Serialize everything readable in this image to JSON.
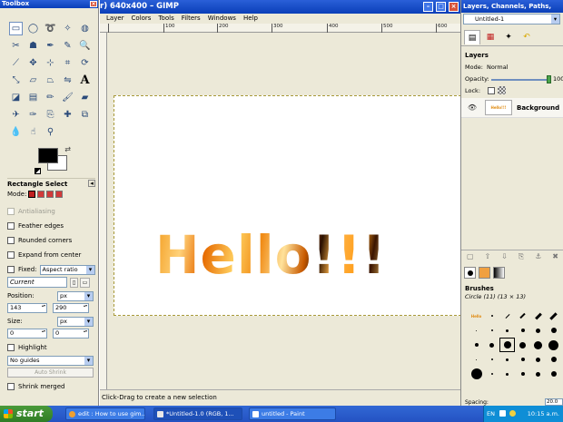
{
  "toolbox": {
    "title": "Toolbox",
    "tool_options_title": "Rectangle Select",
    "mode_label": "Mode:",
    "antialiasing": "Antialiasing",
    "feather_edges": "Feather edges",
    "rounded_corners": "Rounded corners",
    "expand_from_center": "Expand from center",
    "fixed_label": "Fixed:",
    "fixed_value": "Aspect ratio",
    "current_value": "Current",
    "position_label": "Position:",
    "position_unit": "px",
    "pos_x": "143",
    "pos_y": "290",
    "size_label": "Size:",
    "size_unit": "px",
    "size_w": "0",
    "size_h": "0",
    "highlight": "Highlight",
    "guides_value": "No guides",
    "auto_shrink": "Auto Shrink",
    "shrink_merged": "Shrink merged"
  },
  "image_window": {
    "title": "r) 640x400 – GIMP",
    "menu": [
      "Layer",
      "Colors",
      "Tools",
      "Filters",
      "Windows",
      "Help"
    ],
    "ruler_ticks": [
      "100",
      "200",
      "300",
      "400",
      "500",
      "600"
    ],
    "canvas_text": "Hello!!!",
    "status": "Click-Drag to create a new selection"
  },
  "dock": {
    "title": "Layers, Channels, Paths, Undo – Br",
    "image_combo": "Untitled-1",
    "layers_title": "Layers",
    "mode_label": "Mode:",
    "mode_value": "Normal",
    "opacity_label": "Opacity:",
    "opacity_value": "100",
    "lock_label": "Lock:",
    "layer_name": "Background",
    "layer_thumb_text": "Hello!!!",
    "brushes_title": "Brushes",
    "brush_name": "Circle (11) (13 × 13)",
    "spacing_label": "Spacing:",
    "spacing_value": "20.0"
  },
  "taskbar": {
    "start": "start",
    "tasks": [
      "edit : How to use gim...",
      "*Untitled-1.0 (RGB, 1...",
      "untitled - Paint"
    ],
    "lang": "EN",
    "clock": "10:15 a.m."
  }
}
